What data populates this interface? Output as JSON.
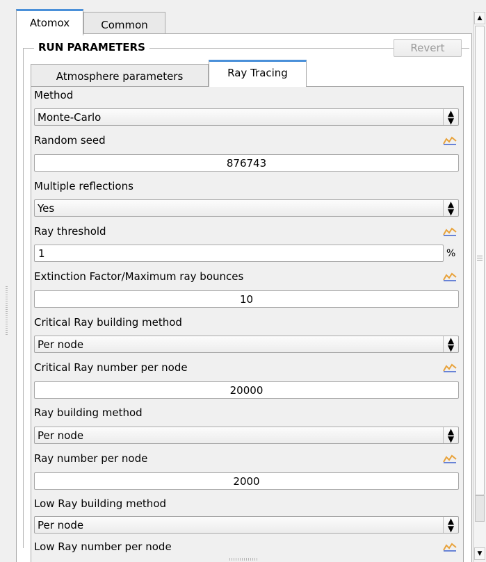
{
  "outer_tabs": [
    {
      "label": "Atomox",
      "active": true
    },
    {
      "label": "Common",
      "active": false
    }
  ],
  "group": {
    "title": "RUN PARAMETERS",
    "revert_label": "Revert"
  },
  "inner_tabs": [
    {
      "label": "Atmosphere parameters",
      "active": false
    },
    {
      "label": "Ray Tracing",
      "active": true
    }
  ],
  "fields": {
    "method": {
      "label": "Method",
      "value": "Monte-Carlo"
    },
    "random_seed": {
      "label": "Random seed",
      "value": "876743"
    },
    "multiple_reflections": {
      "label": "Multiple reflections",
      "value": "Yes"
    },
    "ray_threshold": {
      "label": "Ray threshold",
      "value": "1",
      "unit": "%"
    },
    "extinction": {
      "label": "Extinction Factor/Maximum ray bounces",
      "value": "10"
    },
    "critical_method": {
      "label": "Critical Ray building method",
      "value": "Per node"
    },
    "critical_number": {
      "label": "Critical Ray number per node",
      "value": "20000"
    },
    "ray_method": {
      "label": "Ray building method",
      "value": "Per node"
    },
    "ray_number": {
      "label": "Ray number per node",
      "value": "2000"
    },
    "low_method": {
      "label": "Low Ray building method",
      "value": "Per node"
    },
    "low_number": {
      "label": "Low Ray number per node"
    }
  },
  "icons": {
    "combo_arrow": "up-down-arrows-icon",
    "parameter_graph": "chart-line-icon",
    "scroll_up": "scroll-up-arrow-icon",
    "scroll_down": "scroll-down-arrow-icon"
  },
  "colors": {
    "active_tab_accent": "#4a90d9",
    "chart_icon_orange": "#e8a23a",
    "chart_icon_blue": "#3a5fcd"
  }
}
